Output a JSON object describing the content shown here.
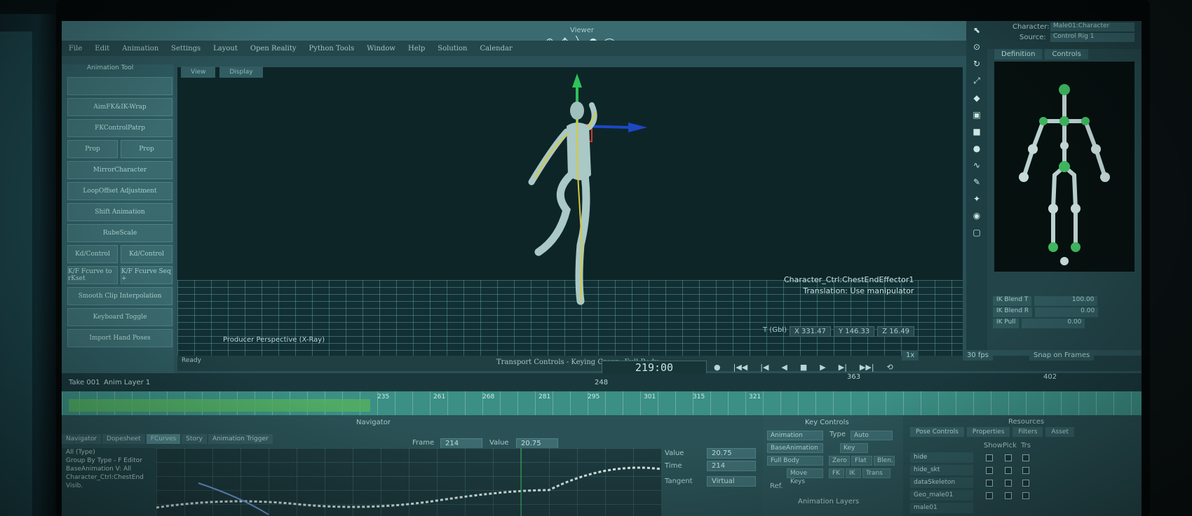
{
  "window": {
    "menu": [
      "File",
      "Edit",
      "Animation",
      "Settings",
      "Layout",
      "Open Reality",
      "Python Tools",
      "Window",
      "Help",
      "Solution",
      "Calendar"
    ],
    "subtitle": "Animation Tool",
    "viewer_label": "Viewer"
  },
  "left_tools": {
    "buttons": [
      "AimFK&IK-Wrap",
      "FKControlPatrp",
      "Prop",
      "Prop",
      "MirrorCharacter",
      "LoopOffset Adjustment",
      "Shift Animation",
      "RubeScale",
      "Kd/Control",
      "Kd/Control",
      "K/F Fcurve to rKset",
      "K/F Fcurve Seq +",
      "Smooth Clip Interpolation",
      "Keyboard Toggle",
      "Import Hand Poses"
    ]
  },
  "viewport": {
    "tabs": [
      "View",
      "Display"
    ],
    "camera_label": "Producer Perspective (X-Ray)",
    "char_info_1": "Character_Ctrl:ChestEndEffector1",
    "char_info_2": "Translation: Use manipulator",
    "coord_label": "T (Gbl)",
    "x": "X  331.47",
    "y": "Y  146.33",
    "z": "Z  16.49"
  },
  "character_panel": {
    "character_label": "Character:",
    "character_value": "Male01:Character",
    "source_label": "Source:",
    "source_value": "Control Rig 1",
    "tabs": [
      "Definition",
      "Controls"
    ],
    "ik_rows": [
      {
        "label": "IK Blend T",
        "value": "100.00"
      },
      {
        "label": "IK Blend R",
        "value": "0.00"
      },
      {
        "label": "IK Pull",
        "value": "0.00"
      }
    ]
  },
  "transport": {
    "status": "Ready",
    "label": "Transport Controls  -  Keying Group: Full Body",
    "frame": "219:00",
    "fps": "30 fps",
    "snap": "Snap on Frames",
    "range_start": "248",
    "range_end": "363",
    "end_value": "402",
    "speed": "1x"
  },
  "timeline": {
    "ticks": [
      "235",
      "261",
      "268",
      "281",
      "295",
      "301",
      "315",
      "321"
    ],
    "take_label": "Take 001",
    "layer_label": "Anim Layer 1"
  },
  "navigator": {
    "title": "Navigator",
    "tabs": [
      "Navigator",
      "Dopesheet",
      "FCurves",
      "Story",
      "Animation Trigger"
    ],
    "frame_label": "Frame",
    "frame_value": "214",
    "value_label": "Value",
    "value_value": "20.75",
    "outline": [
      "All (Type)",
      "Group By Type - F Editor",
      "BaseAnimation  V: All",
      "Character_Ctrl:ChestEnd",
      "Visib."
    ],
    "right_value_label": "Value",
    "right_value": "20.75",
    "time_label": "Time",
    "time_value": "214",
    "tangent_label": "Tangent",
    "tangent_value": "Virtual"
  },
  "key_controls": {
    "title": "Key Controls",
    "animation_label": "Animation",
    "type_label": "Type",
    "type_value": "Auto",
    "base_layer": "BaseAnimation",
    "key_label": "Key",
    "group": "Full Body",
    "zero_label": "Zero",
    "flat_label": "Flat",
    "blend_label": "Blen.",
    "move_keys": "Move Keys",
    "fk_label": "FK",
    "ik_label": "IK",
    "trans_label": "Trans",
    "ref_label": "Ref.",
    "layers_title": "Animation Layers"
  },
  "resources": {
    "title": "Resources",
    "tabs": [
      "Pose Controls",
      "Properties",
      "Filters",
      "Asset"
    ],
    "columns": [
      "Show",
      "Pick",
      "Trs"
    ],
    "items": [
      "hide",
      "hide_skt",
      "dataSkeleton",
      "Geo_male01",
      "male01"
    ]
  },
  "colors": {
    "accent": "#55b05e",
    "x_axis": "#1c48c4",
    "y_axis": "#2ec25a",
    "z_axis": "#d6362b"
  }
}
